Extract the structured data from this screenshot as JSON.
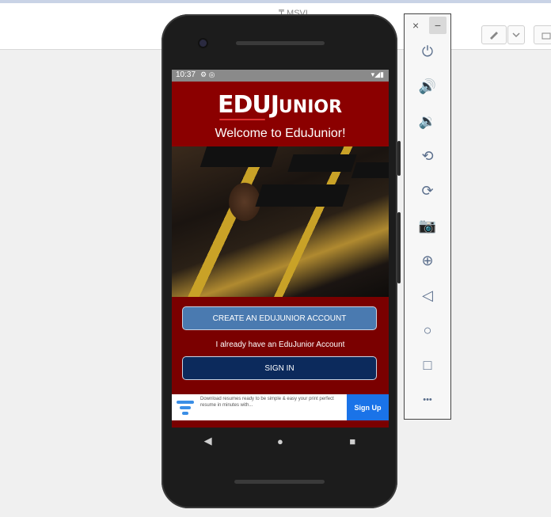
{
  "host": {
    "title": "₸ MSVL",
    "buttons": {
      "pen_icon": "pen-icon",
      "dropdown_icon": "chevron-down-icon",
      "extra_icon": "layer-icon"
    }
  },
  "phone": {
    "status": {
      "time": "10:37",
      "left_icons": "⚙ ◎",
      "right_icons": "▾◢▮"
    },
    "app": {
      "logo_big": "EDUJ",
      "logo_small": "UNIOR",
      "welcome": "Welcome to EduJunior!",
      "create_button": "CREATE AN EDUJUNIOR ACCOUNT",
      "already_text": "I already have an EduJunior Account",
      "signin_button": "SIGN IN",
      "ad": {
        "text": "Download resumes ready to be simple & easy your print perfect resume in minutes with...",
        "cta": "Sign Up"
      }
    },
    "nav": {
      "back": "◀",
      "home": "●",
      "recents": "■"
    }
  },
  "emulator_panel": {
    "close": "×",
    "minimize": "−",
    "items": [
      {
        "name": "power-icon",
        "glyph": "⏻"
      },
      {
        "name": "volume-up-icon",
        "glyph": "🔊"
      },
      {
        "name": "volume-down-icon",
        "glyph": "🔉"
      },
      {
        "name": "rotate-left-icon",
        "glyph": "⟲"
      },
      {
        "name": "rotate-right-icon",
        "glyph": "⟳"
      },
      {
        "name": "camera-icon",
        "glyph": "📷"
      },
      {
        "name": "zoom-icon",
        "glyph": "⊕"
      },
      {
        "name": "back-icon",
        "glyph": "◁"
      },
      {
        "name": "home-icon",
        "glyph": "○"
      },
      {
        "name": "overview-icon",
        "glyph": "□"
      },
      {
        "name": "more-icon",
        "glyph": "•••"
      }
    ]
  },
  "colors": {
    "brand_red": "#8b0000",
    "create_blue": "#4a7ab0",
    "signin_navy": "#0c2a5c",
    "ad_blue": "#1a73e8"
  }
}
